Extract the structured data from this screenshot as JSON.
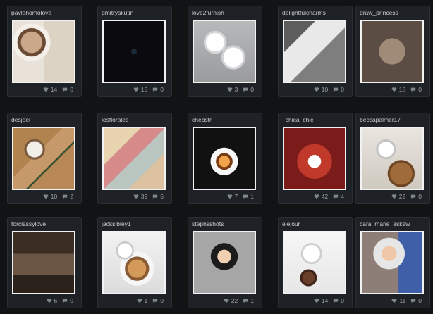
{
  "colors": {
    "background": "#121315",
    "card": "#1e2226",
    "text": "#c8cbd0",
    "muted": "#9aa0a6"
  },
  "icons": {
    "like": "heart-icon",
    "comment": "speech-bubble-icon"
  },
  "cards": [
    {
      "user": "pavlahomolova",
      "likes": "14",
      "comments": "0"
    },
    {
      "user": "dmitryskutin",
      "likes": "15",
      "comments": "0"
    },
    {
      "user": "love2furnish",
      "likes": "3",
      "comments": "0"
    },
    {
      "user": "delightfulcharms",
      "likes": "10",
      "comments": "0"
    },
    {
      "user": "draw_princess",
      "likes": "18",
      "comments": "0"
    },
    {
      "user": "desjoei",
      "likes": "10",
      "comments": "2"
    },
    {
      "user": "lesflorales",
      "likes": "39",
      "comments": "5"
    },
    {
      "user": "chebstr",
      "likes": "7",
      "comments": "1"
    },
    {
      "user": "_chica_chic",
      "likes": "42",
      "comments": "4"
    },
    {
      "user": "beccapalmer17",
      "likes": "22",
      "comments": "0"
    },
    {
      "user": "forclassylove",
      "likes": "6",
      "comments": "0"
    },
    {
      "user": "jacksibley1",
      "likes": "1",
      "comments": "0"
    },
    {
      "user": "stephsshots",
      "likes": "22",
      "comments": "1"
    },
    {
      "user": "elejour",
      "likes": "14",
      "comments": "0"
    },
    {
      "user": "cara_marie_askew",
      "likes": "11",
      "comments": "0"
    }
  ]
}
